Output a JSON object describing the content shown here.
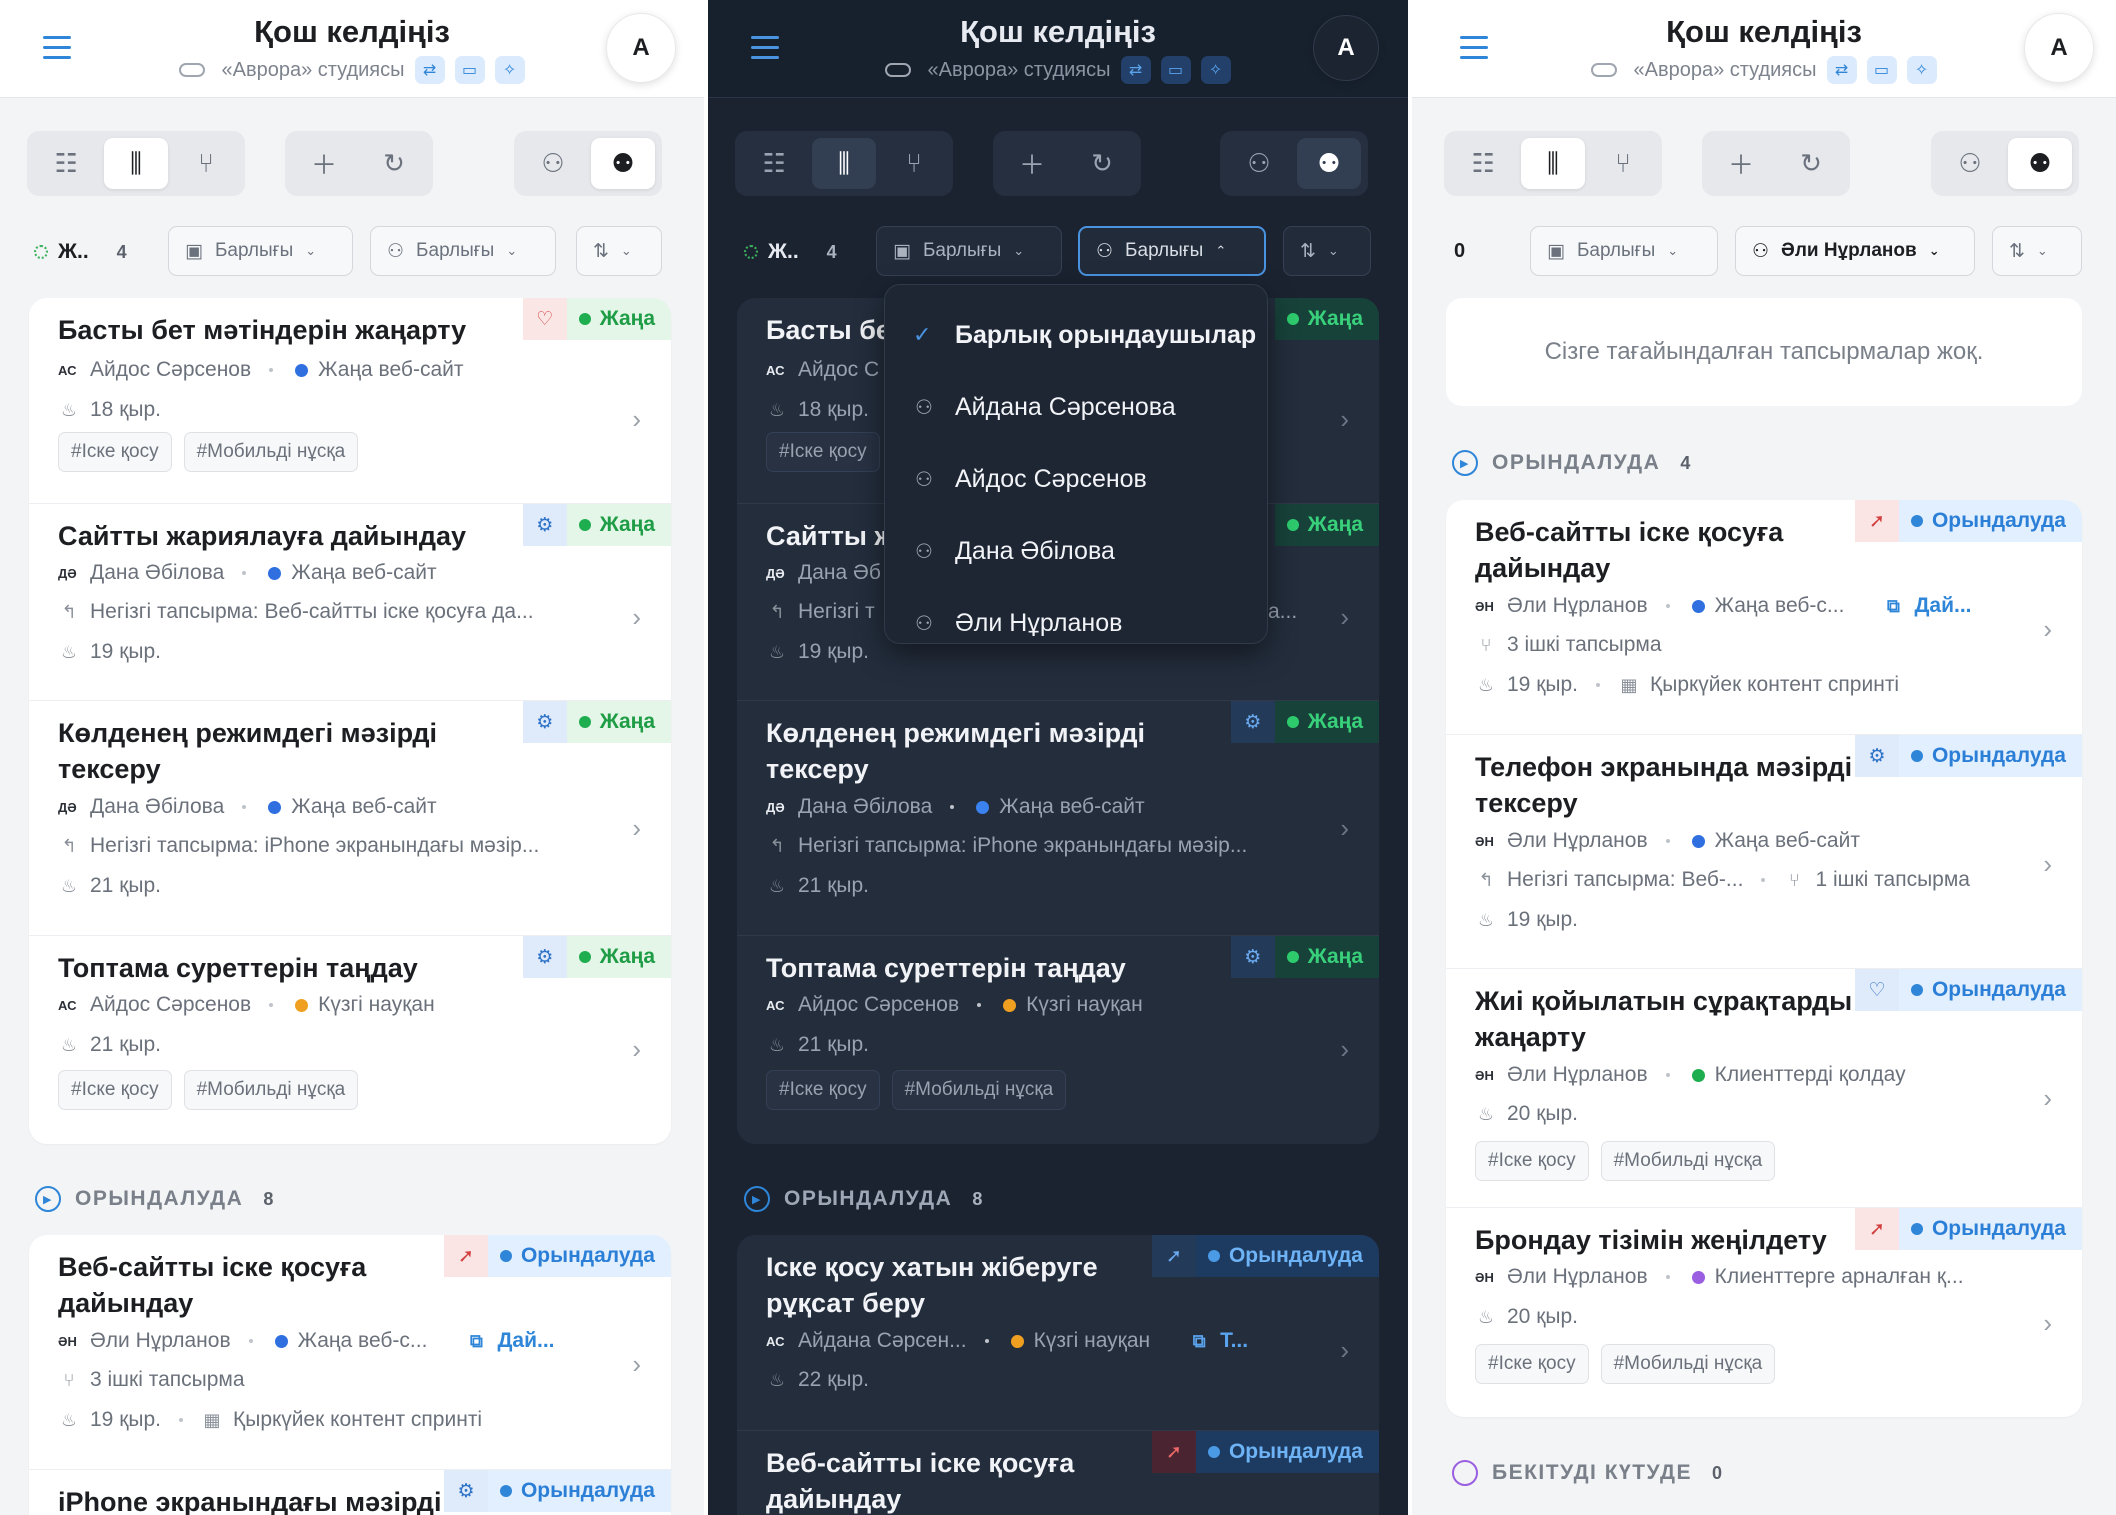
{
  "header": {
    "title": "Қош келдіңіз",
    "studio": "«Аврора» студиясы",
    "avatar_initial": "A"
  },
  "toolbar": {
    "icons": [
      "list-view-icon",
      "board-view-icon",
      "branch-view-icon",
      "add-icon",
      "refresh-icon",
      "single-user-icon",
      "team-icon"
    ]
  },
  "panel_left": {
    "status_label": "Ж..",
    "status_count": "4",
    "filter_project": "Барлығы",
    "filter_assignee": "Барлығы",
    "tasks_new": [
      {
        "title": "Басты бет мәтіндерін жаңарту",
        "status": "Жаңа",
        "initials": "АС",
        "assignee": "Айдос Сәрсенов",
        "project": "Жаңа веб-сайт",
        "age": "18 қыр.",
        "tags": [
          "#Іске қосу",
          "#Мобильді нұсқа"
        ]
      },
      {
        "title": "Сайтты жариялауға дайындау",
        "status": "Жаңа",
        "initials": "ДӘ",
        "assignee": "Дана Әбілова",
        "project": "Жаңа веб-сайт",
        "parent": "Негізгі тапсырма: Веб-сайтты іске қосуға да...",
        "age": "19 қыр."
      },
      {
        "title": "Көлденең режимдегі мәзірді тексеру",
        "status": "Жаңа",
        "initials": "ДӘ",
        "assignee": "Дана Әбілова",
        "project": "Жаңа веб-сайт",
        "parent": "Негізгі тапсырма: iPhone экранындағы мәзір...",
        "age": "21 қыр."
      },
      {
        "title": "Топтама суреттерін таңдау",
        "status": "Жаңа",
        "initials": "АС",
        "assignee": "Айдос Сәрсенов",
        "project": "Күзгі науқан",
        "age": "21 қыр.",
        "tags": [
          "#Іске қосу",
          "#Мобильді нұсқа"
        ]
      }
    ],
    "progress_section": {
      "label": "ОРЫНДАЛУДА",
      "count": "8"
    },
    "tasks_progress": [
      {
        "title": "Веб-сайтты іске қосуға дайындау",
        "status": "Орындалуда",
        "initials": "ӘН",
        "assignee": "Әли Нұрланов",
        "project": "Жаңа веб-с...",
        "link": "Дай...",
        "subtasks": "3 ішкі тапсырма",
        "age": "19 қыр.",
        "sprint": "Қыркүйек контент спринті"
      },
      {
        "title": "iPhone экранындағы мәзірді",
        "status": "Орындалуда"
      }
    ]
  },
  "panel_mid": {
    "status_label": "Ж..",
    "status_count": "4",
    "filter_project": "Барлығы",
    "filter_assignee": "Барлығы",
    "dropdown": [
      {
        "label": "Барлық орындаушылар",
        "selected": true
      },
      {
        "label": "Айдана Сәрсенова"
      },
      {
        "label": "Айдос Сәрсенов"
      },
      {
        "label": "Дана Әбілова"
      },
      {
        "label": "Әли Нұрланов"
      }
    ],
    "tasks_new": [
      {
        "title": "Басты бе",
        "status": "Жаңа",
        "initials": "АС",
        "assignee": "Айдос С",
        "age": "18 қыр.",
        "tag": "#Іске қосу"
      },
      {
        "title": "Сайтты ж",
        "status": "Жаңа",
        "initials": "ДӘ",
        "assignee": "Дана Әб",
        "parent": "Негізгі т",
        "parent_tail": "а...",
        "age": "19 қыр."
      },
      {
        "title": "Көлденең режимдегі мәзірді тексеру",
        "status": "Жаңа",
        "initials": "ДӘ",
        "assignee": "Дана Әбілова",
        "project": "Жаңа веб-сайт",
        "parent": "Негізгі тапсырма: iPhone экранындағы мәзір...",
        "age": "21 қыр."
      },
      {
        "title": "Топтама суреттерін таңдау",
        "status": "Жаңа",
        "initials": "АС",
        "assignee": "Айдос Сәрсенов",
        "project": "Күзгі науқан",
        "age": "21 қыр.",
        "tags": [
          "#Іске қосу",
          "#Мобильді нұсқа"
        ]
      }
    ],
    "progress_section": {
      "label": "ОРЫНДАЛУДА",
      "count": "8"
    },
    "tasks_progress": [
      {
        "title": "Іске қосу хатын жіберуге рұқсат беру",
        "status": "Орындалуда",
        "initials": "АС",
        "assignee": "Айдана Сәрсен...",
        "project": "Күзгі науқан",
        "link": "Т...",
        "age": "22 қыр."
      },
      {
        "title": "Веб-сайтты іске қосуға дайындау",
        "status": "Орындалуда"
      }
    ]
  },
  "panel_right": {
    "count": "0",
    "filter_project": "Барлығы",
    "filter_assignee": "Әли Нұрланов",
    "empty_text": "Сізге тағайындалған тапсырмалар жоқ.",
    "progress_section": {
      "label": "ОРЫНДАЛУДА",
      "count": "4"
    },
    "tasks": [
      {
        "title": "Веб-сайтты іске қосуға дайындау",
        "status": "Орындалуда",
        "initials": "ӘН",
        "assignee": "Әли Нұрланов",
        "project": "Жаңа веб-с...",
        "link": "Дай...",
        "subtasks": "3 ішкі тапсырма",
        "age": "19 қыр.",
        "sprint": "Қыркүйек контент спринті"
      },
      {
        "title": "Телефон экранында мәзірді тексеру",
        "status": "Орындалуда",
        "initials": "ӘН",
        "assignee": "Әли Нұрланов",
        "project": "Жаңа веб-сайт",
        "parent": "Негізгі тапсырма: Веб-...",
        "subtasks": "1 ішкі тапсырма",
        "age": "19 қыр."
      },
      {
        "title": "Жиі қойылатын сұрақтарды жаңарту",
        "status": "Орындалуда",
        "initials": "ӘН",
        "assignee": "Әли Нұрланов",
        "project": "Клиенттерді қолдау",
        "age": "20 қыр.",
        "tags": [
          "#Іске қосу",
          "#Мобильді нұсқа"
        ]
      },
      {
        "title": "Брондау тізімін жеңілдету",
        "status": "Орындалуда",
        "initials": "ӘН",
        "assignee": "Әли Нұрланов",
        "project": "Клиенттерге арналған қ...",
        "age": "20 қыр.",
        "tags": [
          "#Іске қосу",
          "#Мобильді нұсқа"
        ]
      }
    ],
    "awaiting_section": {
      "label": "БЕКІТУДІ КҮТУДЕ",
      "count": "0"
    }
  },
  "colors": {
    "accent": "#2f86d8",
    "new_status": "#1fae4f",
    "project_blue": "#2f6fe0",
    "project_orange": "#f0a020",
    "project_green": "#1fae4f",
    "project_purple": "#9a5ee0",
    "dark_bg": "#1b2331"
  }
}
